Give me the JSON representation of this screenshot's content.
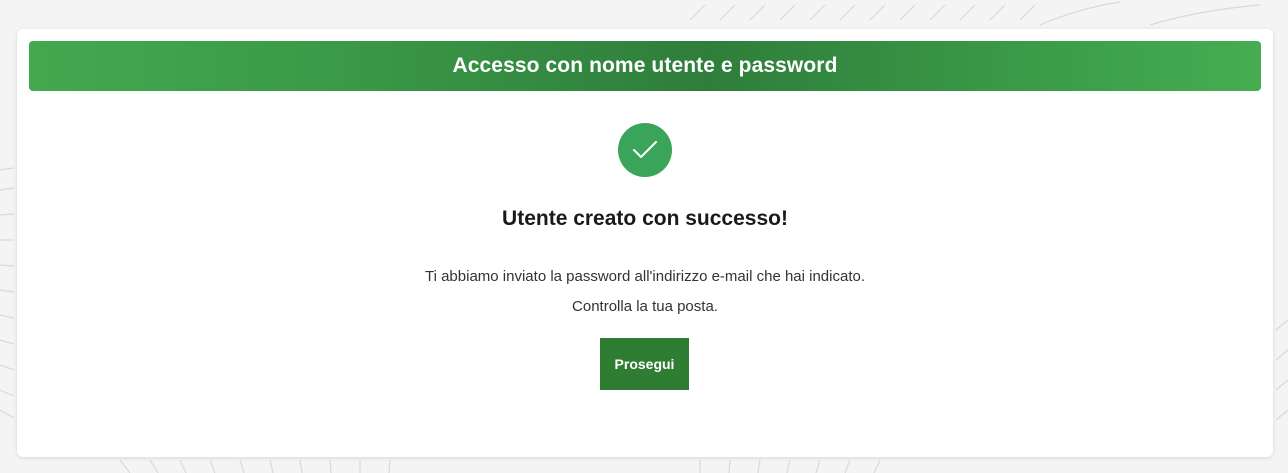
{
  "header": {
    "title": "Accesso con nome utente e password"
  },
  "status": {
    "icon": "check-circle-icon",
    "title": "Utente creato con successo!",
    "message_line1": "Ti abbiamo inviato la password all'indirizzo e-mail che hai indicato.",
    "message_line2": "Controlla la tua posta."
  },
  "actions": {
    "continue_label": "Prosegui"
  },
  "colors": {
    "header_green": "#3a9a47",
    "success_green": "#3aa55a",
    "button_green": "#2e7d32"
  }
}
